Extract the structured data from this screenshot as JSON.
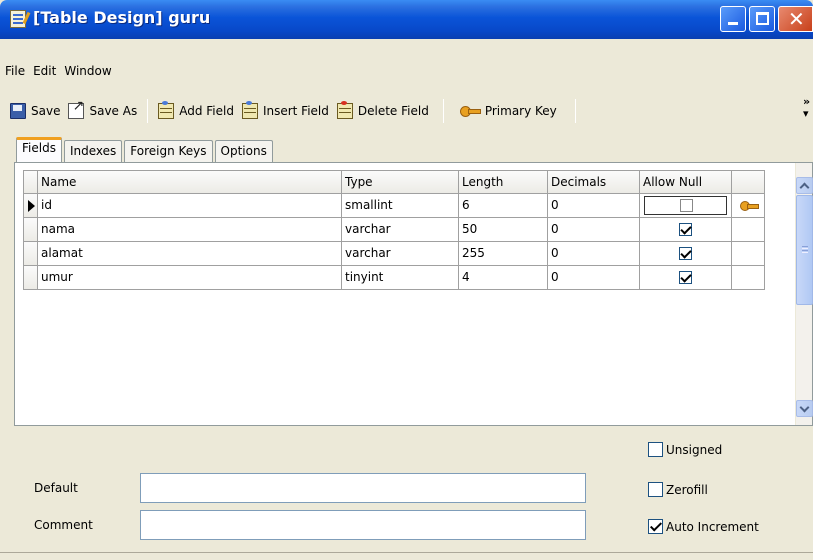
{
  "window": {
    "title": "[Table Design] guru"
  },
  "menu": [
    "File",
    "Edit",
    "Window"
  ],
  "toolbar": {
    "save": "Save",
    "save_as": "Save As",
    "add_field": "Add Field",
    "insert_field": "Insert Field",
    "delete_field": "Delete Field",
    "primary_key": "Primary Key",
    "overflow": "»"
  },
  "tabs": [
    "Fields",
    "Indexes",
    "Foreign Keys",
    "Options"
  ],
  "grid": {
    "columns": [
      "Name",
      "Type",
      "Length",
      "Decimals",
      "Allow Null"
    ],
    "rows": [
      {
        "name": "id",
        "type": "smallint",
        "length": "6",
        "decimals": "0",
        "allow_null": false,
        "primary_key": true
      },
      {
        "name": "nama",
        "type": "varchar",
        "length": "50",
        "decimals": "0",
        "allow_null": true,
        "primary_key": false
      },
      {
        "name": "alamat",
        "type": "varchar",
        "length": "255",
        "decimals": "0",
        "allow_null": true,
        "primary_key": false
      },
      {
        "name": "umur",
        "type": "tinyint",
        "length": "4",
        "decimals": "0",
        "allow_null": true,
        "primary_key": false
      }
    ]
  },
  "form": {
    "default_label": "Default",
    "default_value": "",
    "comment_label": "Comment",
    "comment_value": "",
    "unsigned_label": "Unsigned",
    "unsigned": false,
    "zerofill_label": "Zerofill",
    "zerofill": false,
    "auto_increment_label": "Auto Increment",
    "auto_increment": true
  }
}
